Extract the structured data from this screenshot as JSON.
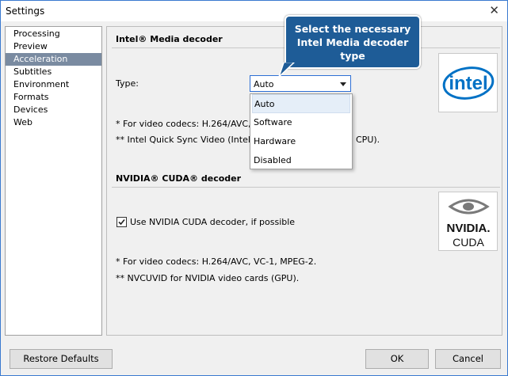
{
  "window": {
    "title": "Settings"
  },
  "nav": {
    "items": [
      {
        "label": "Processing"
      },
      {
        "label": "Preview"
      },
      {
        "label": "Acceleration",
        "selected": true
      },
      {
        "label": "Subtitles"
      },
      {
        "label": "Environment"
      },
      {
        "label": "Formats"
      },
      {
        "label": "Devices"
      },
      {
        "label": "Web"
      }
    ]
  },
  "intel": {
    "title": "Intel® Media decoder",
    "type_label": "Type:",
    "type_value": "Auto",
    "options": [
      "Auto",
      "Software",
      "Hardware",
      "Disabled"
    ],
    "note1": "*  For video codecs: H.264/AVC, V",
    "note2": "** Intel Quick Sync Video (Intel iGP",
    "note2_tail": "CPU).",
    "logo_text": "intel"
  },
  "nvidia": {
    "title": "NVIDIA® CUDA® decoder",
    "checkbox_label": "Use NVIDIA CUDA decoder, if possible",
    "checked": true,
    "note1": "*  For video codecs: H.264/AVC, VC-1, MPEG-2.",
    "note2": "** NVCUVID for NVIDIA video cards (GPU).",
    "logo_brand": "NVIDIA.",
    "logo_product": "CUDA"
  },
  "callout": {
    "line1": "Select the necessary",
    "line2": "Intel Media decoder",
    "line3": "type"
  },
  "footer": {
    "restore": "Restore Defaults",
    "ok": "OK",
    "cancel": "Cancel"
  },
  "colors": {
    "nav_selected": "#7a8ba1",
    "callout_bg": "#1e5c97",
    "intel_blue": "#0071c5",
    "border_accent": "#3a7ad0"
  }
}
